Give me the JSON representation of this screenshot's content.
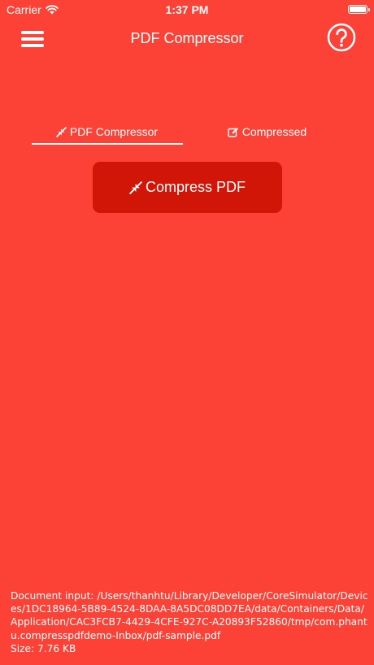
{
  "status_bar": {
    "carrier": "Carrier",
    "time": "1:37 PM",
    "battery_level": 1.0
  },
  "nav": {
    "title": "PDF Compressor",
    "menu_icon": "hamburger-menu-icon",
    "help_icon": "question-circle-icon"
  },
  "tabs": [
    {
      "label": "PDF Compressor",
      "icon": "compress-arrows-icon",
      "selected": true
    },
    {
      "label": "Compressed",
      "icon": "edit-square-icon",
      "selected": false
    }
  ],
  "compress_button": {
    "label": "Compress PDF",
    "icon": "compress-arrows-icon"
  },
  "document": {
    "input_label": "Document input:",
    "path": "/Users/thanhtu/Library/Developer/CoreSimulator/Devices/1DC18964-5B89-4524-8DAA-8A5DC08DD7EA/data/Containers/Data/Application/CAC3FCB7-4429-4CFE-927C-A20893F52860/tmp/com.phantu.compresspdfdemo-Inbox/pdf-sample.pdf",
    "size_label": "Size:",
    "size": "7.76 KB"
  },
  "colors": {
    "background": "#fc4236",
    "button": "#d11506",
    "text": "#ffffff"
  }
}
